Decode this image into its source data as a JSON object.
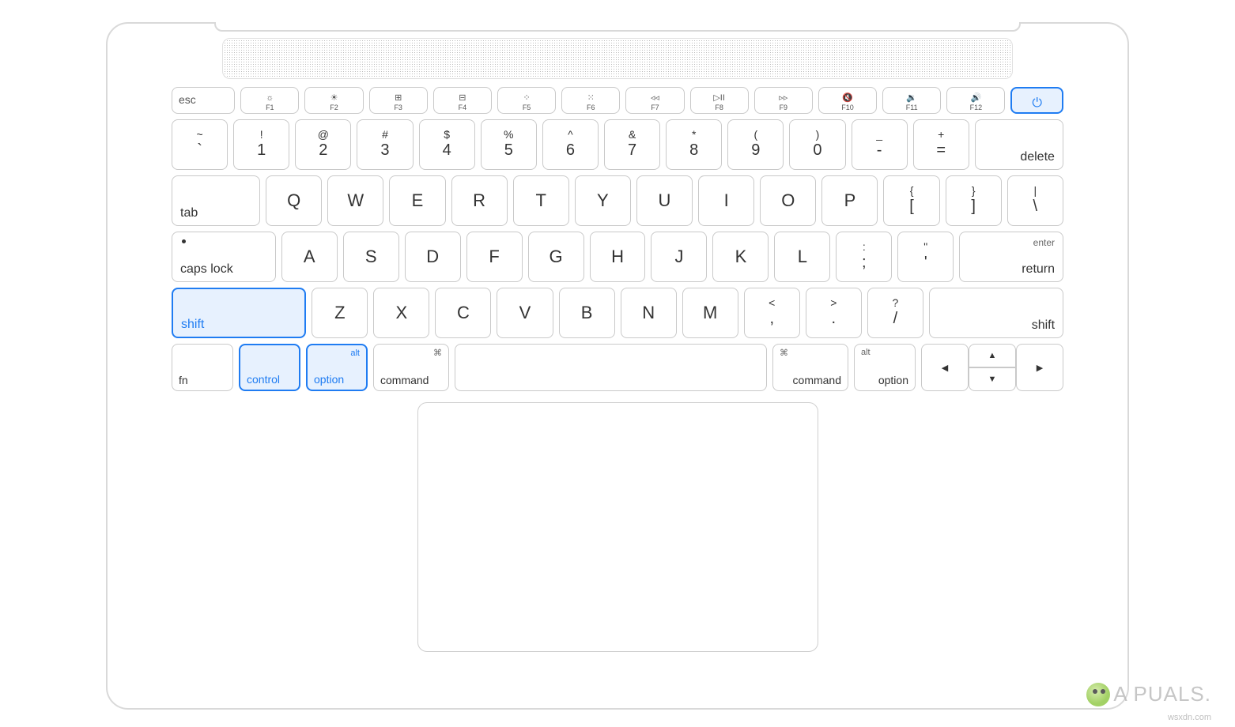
{
  "highlighted_keys": [
    "shift-left",
    "control",
    "option-left",
    "power"
  ],
  "rows": {
    "fn": {
      "esc": "esc",
      "f1": "F1",
      "f2": "F2",
      "f3": "F3",
      "f4": "F4",
      "f5": "F5",
      "f6": "F6",
      "f7": "F7",
      "f8": "F8",
      "f9": "F9",
      "f10": "F10",
      "f11": "F11",
      "f12": "F12",
      "power": "⏻"
    },
    "num": {
      "0": {
        "upper": "~",
        "lower": "`"
      },
      "1": {
        "upper": "!",
        "lower": "1"
      },
      "2": {
        "upper": "@",
        "lower": "2"
      },
      "3": {
        "upper": "#",
        "lower": "3"
      },
      "4": {
        "upper": "$",
        "lower": "4"
      },
      "5": {
        "upper": "%",
        "lower": "5"
      },
      "6": {
        "upper": "^",
        "lower": "6"
      },
      "7": {
        "upper": "&",
        "lower": "7"
      },
      "8": {
        "upper": "*",
        "lower": "8"
      },
      "9": {
        "upper": "(",
        "lower": "9"
      },
      "10": {
        "upper": ")",
        "lower": "0"
      },
      "11": {
        "upper": "_",
        "lower": "-"
      },
      "12": {
        "upper": "+",
        "lower": "="
      },
      "delete": "delete"
    },
    "q": {
      "tab": "tab",
      "letters": [
        "Q",
        "W",
        "E",
        "R",
        "T",
        "Y",
        "U",
        "I",
        "O",
        "P"
      ],
      "brackets": [
        {
          "upper": "{",
          "lower": "["
        },
        {
          "upper": "}",
          "lower": "]"
        },
        {
          "upper": "|",
          "lower": "\\"
        }
      ]
    },
    "a": {
      "caps": "caps lock",
      "letters": [
        "A",
        "S",
        "D",
        "F",
        "G",
        "H",
        "J",
        "K",
        "L"
      ],
      "punct": [
        {
          "upper": ":",
          "lower": ";"
        },
        {
          "upper": "\"",
          "lower": "'"
        }
      ],
      "enter": "enter",
      "return": "return"
    },
    "z": {
      "shift": "shift",
      "letters": [
        "Z",
        "X",
        "C",
        "V",
        "B",
        "N",
        "M"
      ],
      "punct": [
        {
          "upper": "<",
          "lower": ","
        },
        {
          "upper": ">",
          "lower": "."
        },
        {
          "upper": "?",
          "lower": "/"
        }
      ]
    },
    "mod": {
      "fn": "fn",
      "control": "control",
      "option": "option",
      "alt": "alt",
      "command": "command",
      "cmd_sym": "⌘",
      "arrows": {
        "left": "◀",
        "up": "▲",
        "down": "▼",
        "right": "▶"
      }
    }
  },
  "watermark": {
    "brand": "A  PUALS.",
    "domain": "wsxdn.com"
  },
  "colors": {
    "highlight_border": "#1f7cf2",
    "highlight_fill": "#e7f1fe",
    "key_border": "#c9c9c9"
  }
}
